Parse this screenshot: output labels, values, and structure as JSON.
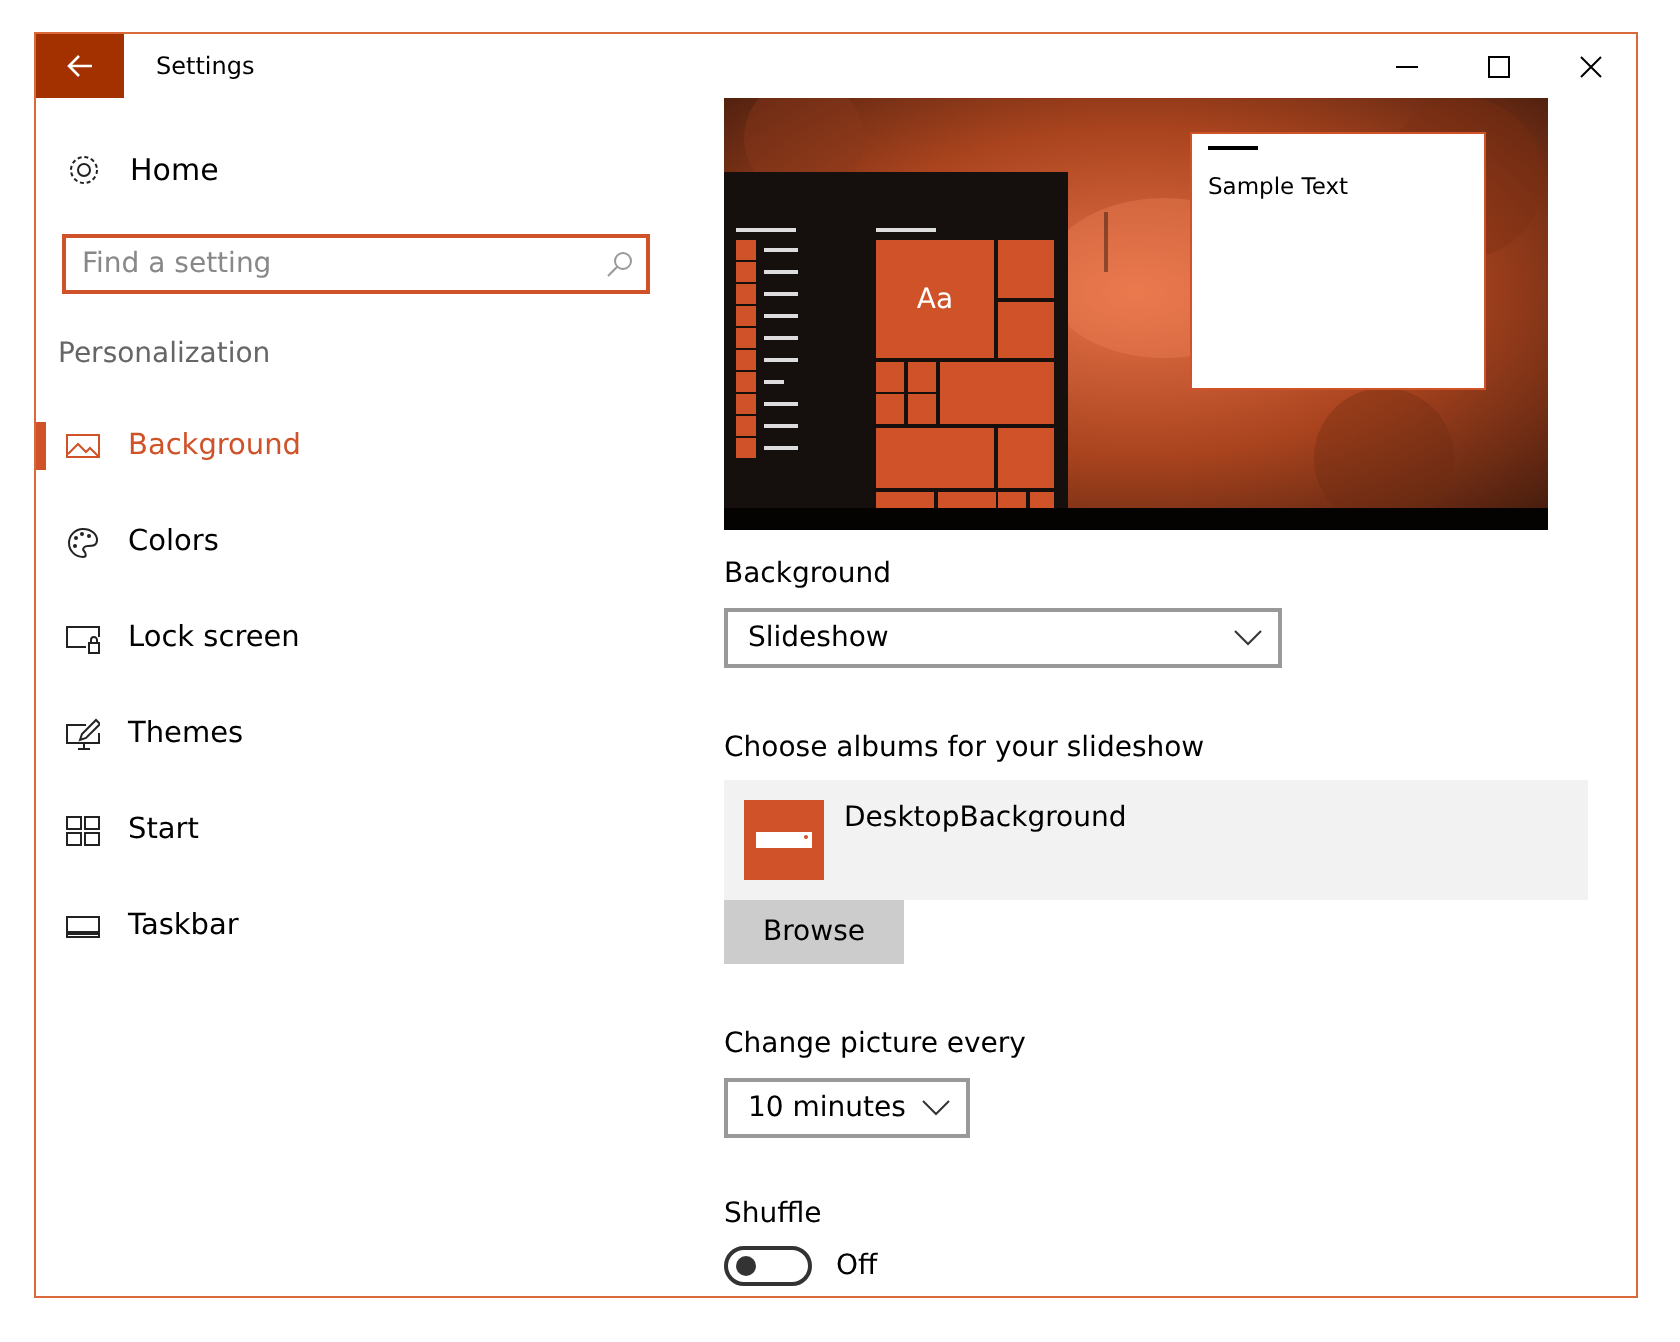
{
  "window": {
    "title": "Settings"
  },
  "sidebar": {
    "home": "Home",
    "search": {
      "placeholder": "Find a setting"
    },
    "section": "Personalization",
    "items": [
      {
        "label": "Background",
        "selected": true
      },
      {
        "label": "Colors",
        "selected": false
      },
      {
        "label": "Lock screen",
        "selected": false
      },
      {
        "label": "Themes",
        "selected": false
      },
      {
        "label": "Start",
        "selected": false
      },
      {
        "label": "Taskbar",
        "selected": false
      }
    ]
  },
  "preview": {
    "tile_text": "Aa",
    "window_text": "Sample Text"
  },
  "background": {
    "label": "Background",
    "value": "Slideshow"
  },
  "albums": {
    "label": "Choose albums for your slideshow",
    "items": [
      {
        "name": "DesktopBackground"
      }
    ],
    "browse": "Browse"
  },
  "interval": {
    "label": "Change picture every",
    "value": "10 minutes"
  },
  "shuffle": {
    "label": "Shuffle",
    "on": false,
    "state_text": "Off"
  }
}
